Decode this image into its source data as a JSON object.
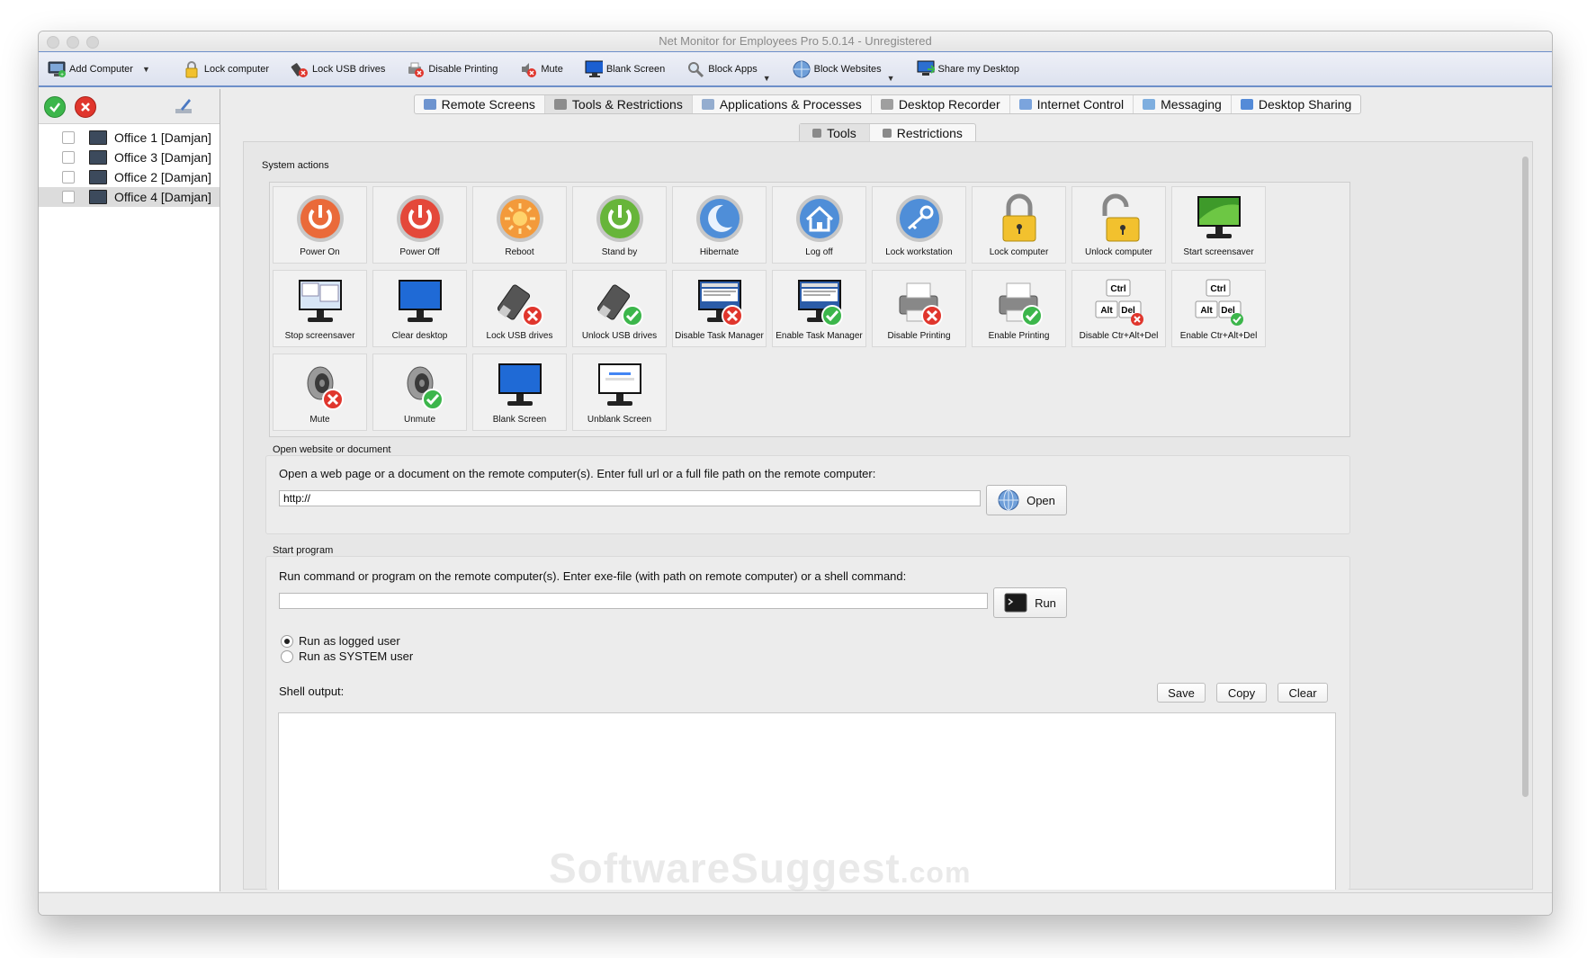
{
  "window": {
    "title": "Net Monitor for Employees Pro 5.0.14 - Unregistered"
  },
  "toolbar": {
    "items": [
      {
        "label": "Add Computer",
        "icon": "computer-add-icon",
        "dropdown": true
      },
      {
        "label": "Lock computer",
        "icon": "padlock-icon"
      },
      {
        "label": "Lock USB drives",
        "icon": "usb-lock-icon"
      },
      {
        "label": "Disable Printing",
        "icon": "printer-disable-icon"
      },
      {
        "label": "Mute",
        "icon": "speaker-mute-icon"
      },
      {
        "label": "Blank Screen",
        "icon": "monitor-icon"
      },
      {
        "label": "Block Apps",
        "icon": "magnifier-icon",
        "dropdown": true
      },
      {
        "label": "Block Websites",
        "icon": "globe-icon",
        "dropdown": true
      },
      {
        "label": "Share my Desktop",
        "icon": "desktop-share-icon"
      }
    ]
  },
  "computers": [
    {
      "label": "Office 1 [Damjan]",
      "selected": false
    },
    {
      "label": "Office 3 [Damjan]",
      "selected": false
    },
    {
      "label": "Office 2 [Damjan]",
      "selected": false
    },
    {
      "label": "Office 4 [Damjan]",
      "selected": true
    }
  ],
  "tabs": {
    "main": [
      {
        "label": "Remote Screens",
        "active": false
      },
      {
        "label": "Tools & Restrictions",
        "active": true
      },
      {
        "label": "Applications & Processes",
        "active": false
      },
      {
        "label": "Desktop Recorder",
        "active": false
      },
      {
        "label": "Internet Control",
        "active": false
      },
      {
        "label": "Messaging",
        "active": false
      },
      {
        "label": "Desktop Sharing",
        "active": false
      }
    ],
    "sub": [
      {
        "label": "Tools",
        "active": true
      },
      {
        "label": "Restrictions",
        "active": false
      }
    ]
  },
  "system_actions": {
    "title": "System actions",
    "items": [
      {
        "label": "Power On",
        "icon": "power-on-icon"
      },
      {
        "label": "Power Off",
        "icon": "power-off-icon"
      },
      {
        "label": "Reboot",
        "icon": "reboot-icon"
      },
      {
        "label": "Stand by",
        "icon": "standby-icon"
      },
      {
        "label": "Hibernate",
        "icon": "hibernate-moon-icon"
      },
      {
        "label": "Log off",
        "icon": "logoff-home-icon"
      },
      {
        "label": "Lock workstation",
        "icon": "key-icon"
      },
      {
        "label": "Lock computer",
        "icon": "padlock-closed-icon"
      },
      {
        "label": "Unlock computer",
        "icon": "padlock-open-icon"
      },
      {
        "label": "Start screensaver",
        "icon": "screensaver-start-icon"
      },
      {
        "label": "Stop screensaver",
        "icon": "screensaver-stop-icon"
      },
      {
        "label": "Clear desktop",
        "icon": "clear-desktop-icon"
      },
      {
        "label": "Lock USB drives",
        "icon": "usb-lock-icon"
      },
      {
        "label": "Unlock USB drives",
        "icon": "usb-unlock-icon"
      },
      {
        "label": "Disable Task Manager",
        "icon": "task-manager-disable-icon"
      },
      {
        "label": "Enable Task Manager",
        "icon": "task-manager-enable-icon"
      },
      {
        "label": "Disable Printing",
        "icon": "printer-disable-icon"
      },
      {
        "label": "Enable Printing",
        "icon": "printer-enable-icon"
      },
      {
        "label": "Disable Ctr+Alt+Del",
        "icon": "ctrl-alt-del-disable-icon"
      },
      {
        "label": "Enable Ctr+Alt+Del",
        "icon": "ctrl-alt-del-enable-icon"
      },
      {
        "label": "Mute",
        "icon": "speaker-mute-icon"
      },
      {
        "label": "Unmute",
        "icon": "speaker-unmute-icon"
      },
      {
        "label": "Blank Screen",
        "icon": "blank-screen-icon"
      },
      {
        "label": "Unblank Screen",
        "icon": "unblank-screen-icon"
      }
    ],
    "keys": {
      "ctrl": "Ctrl",
      "alt": "Alt",
      "del": "Del"
    }
  },
  "open_website": {
    "title": "Open website or document",
    "description": "Open a web page or a document on the remote computer(s). Enter full url or a full file path on the remote computer:",
    "value": "http://",
    "button": "Open"
  },
  "start_program": {
    "title": "Start program",
    "description": "Run command or program on the remote computer(s). Enter exe-file (with path on remote computer) or a shell command:",
    "value": "",
    "button": "Run",
    "options": [
      {
        "label": "Run as logged user",
        "selected": true
      },
      {
        "label": "Run as SYSTEM user",
        "selected": false
      }
    ],
    "shell_output_label": "Shell output:",
    "shell_buttons": {
      "save": "Save",
      "copy": "Copy",
      "clear": "Clear"
    }
  },
  "watermark": {
    "main": "SoftwareSuggest",
    "suffix": ".com"
  },
  "colors": {
    "accent": "#6d8fc9",
    "ok": "#3cb64b",
    "error": "#e0362d"
  }
}
